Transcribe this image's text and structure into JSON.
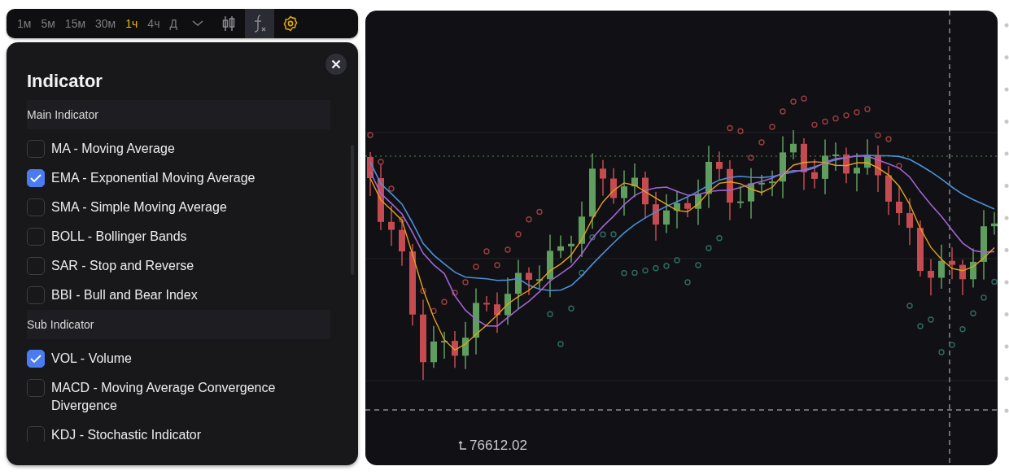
{
  "toolbar": {
    "timeframes": [
      {
        "label": "1м",
        "selected": false
      },
      {
        "label": "5м",
        "selected": false
      },
      {
        "label": "15м",
        "selected": false
      },
      {
        "label": "30м",
        "selected": false
      },
      {
        "label": "1ч",
        "selected": true
      },
      {
        "label": "4ч",
        "selected": false
      },
      {
        "label": "Д",
        "selected": false
      }
    ],
    "tools": [
      {
        "kind": "dropdown",
        "selected": false
      },
      {
        "kind": "candles",
        "selected": false
      },
      {
        "kind": "indicator",
        "selected": true
      },
      {
        "kind": "settings",
        "selected": false
      }
    ]
  },
  "indicator_panel": {
    "title": "Indicator",
    "sections": [
      {
        "title": "Main Indicator",
        "items": [
          {
            "label": "MA - Moving Average",
            "checked": false
          },
          {
            "label": "EMA - Exponential Moving Average",
            "checked": true
          },
          {
            "label": "SMA - Simple Moving Average",
            "checked": false
          },
          {
            "label": "BOLL - Bollinger Bands",
            "checked": false
          },
          {
            "label": "SAR - Stop and Reverse",
            "checked": false
          },
          {
            "label": "BBI - Bull and Bear Index",
            "checked": false
          }
        ]
      },
      {
        "title": "Sub Indicator",
        "items": [
          {
            "label": "VOL - Volume",
            "checked": true
          },
          {
            "label": "MACD - Moving Average Convergence Divergence",
            "checked": false
          },
          {
            "label": "KDJ - Stochastic Indicator",
            "checked": false
          }
        ]
      }
    ]
  },
  "chart": {
    "low_label": "76612.02"
  }
}
